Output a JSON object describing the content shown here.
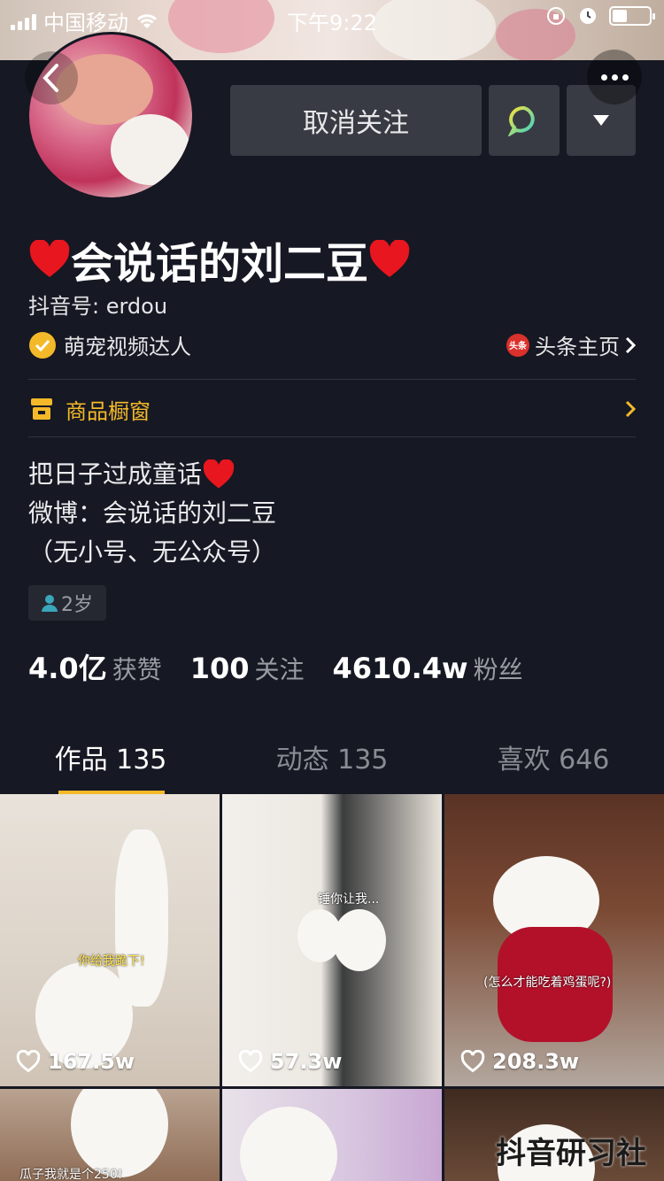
{
  "status_bar": {
    "carrier": "中国移动",
    "time": "下午9:22"
  },
  "profile": {
    "name": "会说话的刘二豆",
    "douyin_id": "抖音号: erdou",
    "verification": "萌宠视频达人",
    "toutiao_link": "头条主页",
    "toutiao_badge": "头条"
  },
  "actions": {
    "unfollow_label": "取消关注"
  },
  "shop": {
    "label": "商品橱窗"
  },
  "bio": {
    "line1": "把日子过成童话",
    "line2": "微博：会说话的刘二豆",
    "line3": "（无小号、无公众号）"
  },
  "age_chip": "2岁",
  "stats": {
    "likes_value": "4.0亿",
    "likes_label": "获赞",
    "following_value": "100",
    "following_label": "关注",
    "fans_value": "4610.4w",
    "fans_label": "粉丝"
  },
  "tabs": [
    {
      "label": "作品 135",
      "active": true
    },
    {
      "label": "动态 135",
      "active": false
    },
    {
      "label": "喜欢 646",
      "active": false
    }
  ],
  "videos": [
    {
      "likes": "167.5w",
      "caption": "你给我跪下!"
    },
    {
      "likes": "57.3w",
      "caption": "锤你让我..."
    },
    {
      "likes": "208.3w",
      "caption": "(怎么才能吃着鸡蛋呢?)"
    },
    {
      "caption": "瓜子我就是个250!"
    },
    {
      "caption": ""
    },
    {
      "caption": "抖音研习社"
    }
  ],
  "colors": {
    "accent": "#f3b929",
    "background": "#161823",
    "button": "#393b44"
  }
}
